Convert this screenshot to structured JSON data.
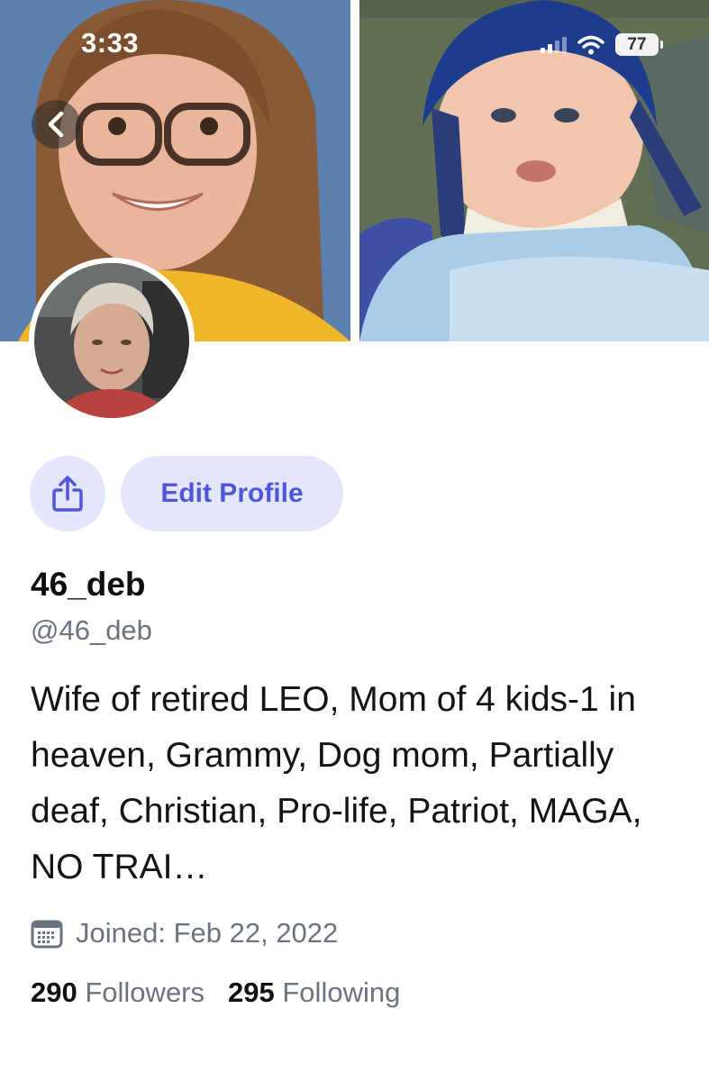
{
  "status_bar": {
    "time": "3:33",
    "battery": "77"
  },
  "profile": {
    "display_name": "46_deb",
    "handle": "@46_deb",
    "bio": "Wife of retired LEO, Mom of 4 kids-1 in heaven, Grammy, Dog mom, Partially deaf, Christian, Pro-life, Patriot, MAGA, NO TRAI…",
    "joined": "Joined: Feb 22, 2022",
    "followers_count": "290",
    "followers_label": "Followers",
    "following_count": "295",
    "following_label": "Following"
  },
  "actions": {
    "edit_profile_label": "Edit Profile"
  },
  "icons": {
    "back": "chevron-left-icon",
    "share": "share-icon",
    "calendar": "calendar-icon"
  },
  "colors": {
    "accent": "#4f57d8",
    "button_bg": "#e4e7fb",
    "muted_text": "#6b7280"
  }
}
